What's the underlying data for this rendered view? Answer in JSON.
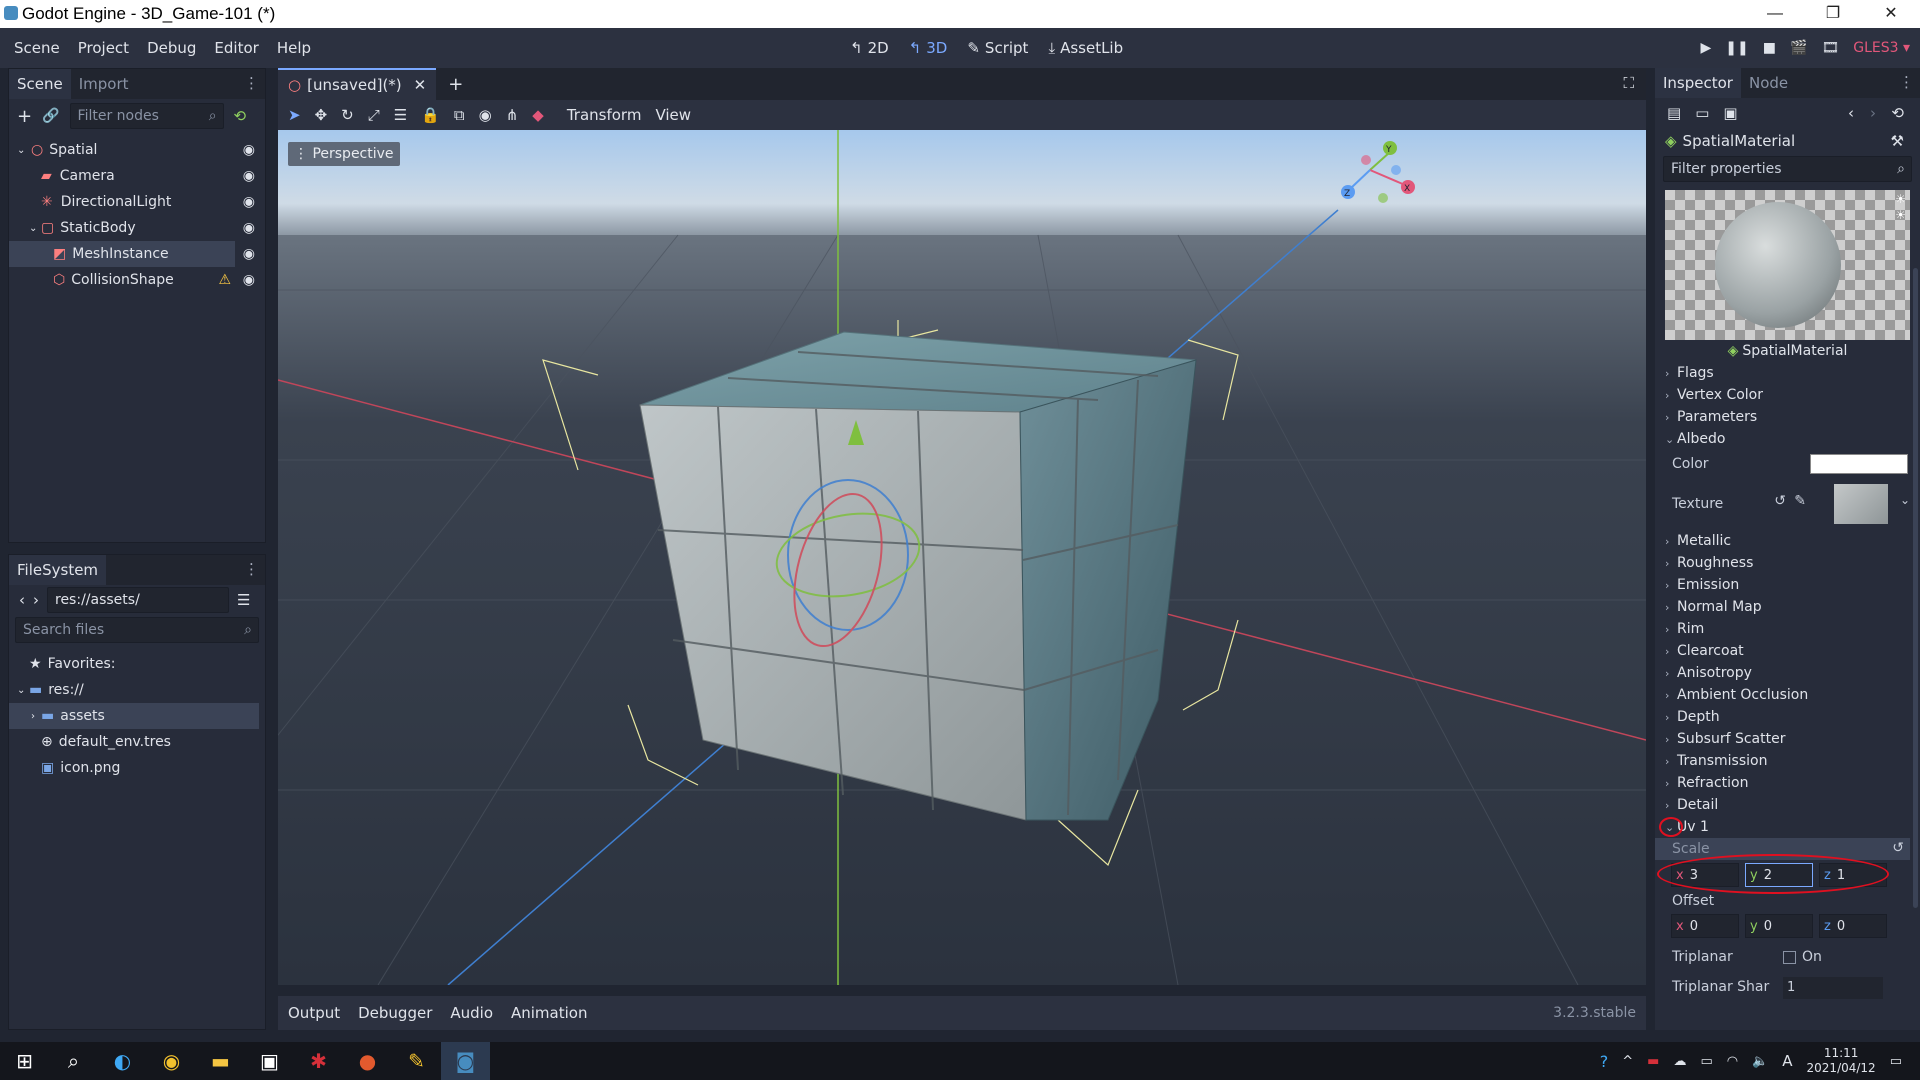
{
  "window": {
    "title": "Godot Engine - 3D_Game-101 (*)",
    "controls": [
      "—",
      "❐",
      "✕"
    ]
  },
  "menubar": {
    "menus": [
      "Scene",
      "Project",
      "Debug",
      "Editor",
      "Help"
    ],
    "workspaces": [
      {
        "label": "2D",
        "icon": "2d-icon"
      },
      {
        "label": "3D",
        "icon": "3d-icon"
      },
      {
        "label": "Script",
        "icon": "script-icon"
      },
      {
        "label": "AssetLib",
        "icon": "assetlib-icon"
      }
    ],
    "renderer": "GLES3"
  },
  "scene_dock": {
    "tabs": [
      "Scene",
      "Import"
    ],
    "filter_placeholder": "Filter nodes",
    "nodes": [
      {
        "label": "Spatial",
        "indent": 0,
        "color": "#fc7f7f"
      },
      {
        "label": "Camera",
        "indent": 1,
        "color": "#fc7f7f"
      },
      {
        "label": "DirectionalLight",
        "indent": 1,
        "color": "#fc7f7f"
      },
      {
        "label": "StaticBody",
        "indent": 1,
        "color": "#fc7f7f"
      },
      {
        "label": "MeshInstance",
        "indent": 2,
        "color": "#fc7f7f"
      },
      {
        "label": "CollisionShape",
        "indent": 2,
        "color": "#fc7f7f",
        "warning": true
      }
    ]
  },
  "filesystem_dock": {
    "tab": "FileSystem",
    "path": "res://assets/",
    "search_placeholder": "Search files",
    "items": [
      {
        "label": "Favorites:",
        "icon": "star-icon",
        "indent": 0
      },
      {
        "label": "res://",
        "icon": "folder-icon",
        "indent": 0
      },
      {
        "label": "assets",
        "icon": "folder-icon",
        "indent": 1
      },
      {
        "label": "default_env.tres",
        "icon": "globe-icon",
        "indent": 1
      },
      {
        "label": "icon.png",
        "icon": "image-icon",
        "indent": 1
      }
    ]
  },
  "viewport": {
    "tab_label": "[unsaved](*)",
    "toolbar_menus": [
      "Transform",
      "View"
    ],
    "perspective_label": "Perspective",
    "gizmo_labels": {
      "x": "X",
      "y": "Y",
      "z": "Z"
    }
  },
  "bottom_panel": {
    "tabs": [
      "Output",
      "Debugger",
      "Audio",
      "Animation"
    ],
    "version": "3.2.3.stable"
  },
  "inspector": {
    "tabs": [
      "Inspector",
      "Node"
    ],
    "resource_name": "SpatialMaterial",
    "filter_placeholder": "Filter properties",
    "preview_label": "SpatialMaterial",
    "sections_top": [
      "Flags",
      "Vertex Color",
      "Parameters"
    ],
    "albedo": {
      "label": "Albedo",
      "color_label": "Color",
      "color_value": "#ffffff",
      "texture_label": "Texture"
    },
    "sections_mid": [
      "Metallic",
      "Roughness",
      "Emission",
      "Normal Map",
      "Rim",
      "Clearcoat",
      "Anisotropy",
      "Ambient Occlusion",
      "Depth",
      "Subsurf Scatter",
      "Transmission",
      "Refraction",
      "Detail"
    ],
    "uv1": {
      "label": "Uv 1",
      "scale_label": "Scale",
      "scale": {
        "x": "3",
        "y": "2",
        "z": "1"
      },
      "offset_label": "Offset",
      "offset": {
        "x": "0",
        "y": "0",
        "z": "0"
      },
      "triplanar_label": "Triplanar",
      "triplanar_value": "On",
      "triplanar_sharp_label": "Triplanar Shar",
      "triplanar_sharp_value": "1"
    }
  },
  "taskbar": {
    "time": "11:11",
    "date": "2021/04/12",
    "ime": "A"
  }
}
